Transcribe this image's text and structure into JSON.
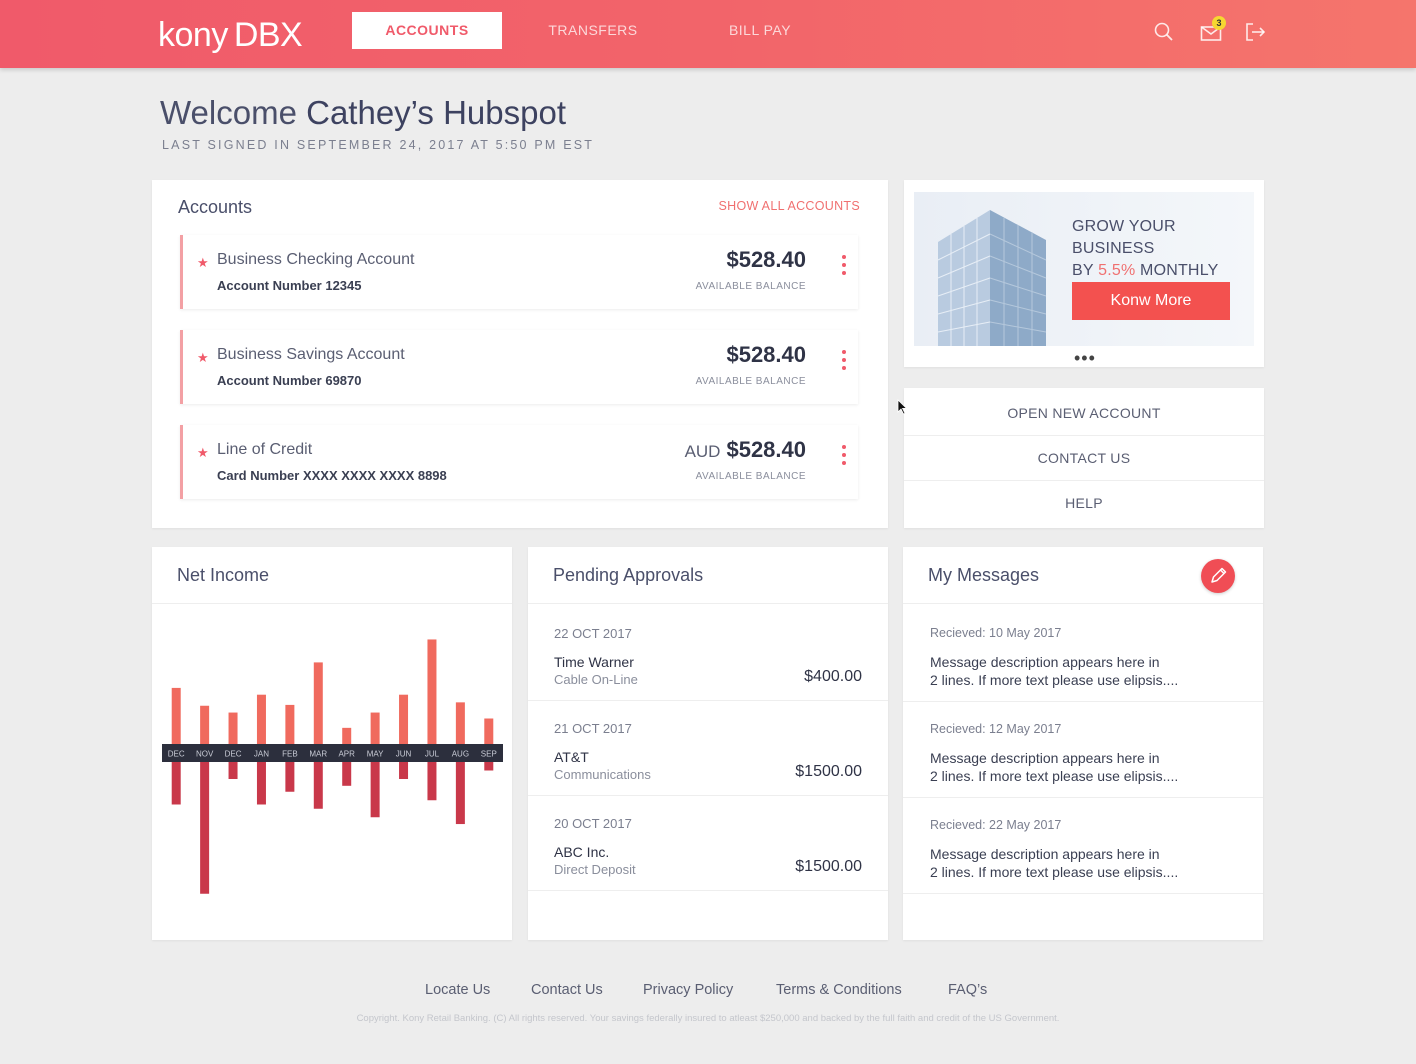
{
  "header": {
    "logo_kony": "kony",
    "logo_dbx": "DBX",
    "tabs": [
      {
        "label": "ACCOUNTS",
        "active": true
      },
      {
        "label": "TRANSFERS",
        "active": false
      },
      {
        "label": "BILL PAY",
        "active": false
      }
    ],
    "icons": [
      "search-icon",
      "mail-icon",
      "logout-icon"
    ],
    "mail_badge": "3",
    "colors": {
      "brand": "#f05a6a",
      "badge": "#f6d731"
    }
  },
  "welcome": {
    "prefix": "Welcome",
    "name": "Cathey’s Hubspot",
    "last_signed": "LAST SIGNED IN SEPTEMBER 24, 2017 AT 5:50 PM EST"
  },
  "accounts": {
    "title": "Accounts",
    "show_all": "SHOW ALL ACCOUNTS",
    "items": [
      {
        "name": "Business Checking Account",
        "number": "Account Number 12345",
        "currency": "",
        "balance": "$528.40",
        "balance_label": "AVAILABLE BALANCE"
      },
      {
        "name": "Business Savings Account",
        "number": "Account Number 69870",
        "currency": "",
        "balance": "$528.40",
        "balance_label": "AVAILABLE BALANCE"
      },
      {
        "name": "Line of Credit",
        "number": "Card Number XXXX XXXX XXXX 8898",
        "currency": "AUD",
        "balance": "$528.40",
        "balance_label": "AVAILABLE BALANCE"
      }
    ]
  },
  "promo": {
    "line1": "GROW YOUR BUSINESS",
    "line2_prefix": "BY ",
    "line2_pct": "5.5%",
    "line2_suffix": " MONTHLY",
    "button": "Konw More",
    "dots": "•••"
  },
  "quick_links": [
    "OPEN NEW ACCOUNT",
    "CONTACT US",
    "HELP"
  ],
  "net_income": {
    "title": "Net Income",
    "chart_data": {
      "type": "bar",
      "title": "Net Income",
      "categories": [
        "DEC",
        "NOV",
        "DEC",
        "JAN",
        "FEB",
        "MAR",
        "APR",
        "MAY",
        "JUN",
        "JUL",
        "AUG",
        "SEP"
      ],
      "series": [
        {
          "values": [
            66,
            45,
            37,
            58,
            46,
            96,
            19,
            37,
            58,
            123,
            49,
            30
          ]
        },
        {
          "values": [
            -50,
            -155,
            -20,
            -50,
            -35,
            -55,
            -28,
            -65,
            -20,
            -45,
            -73,
            -10
          ]
        }
      ],
      "colors": {
        "income": "#f06a5e",
        "expense": "#c9384a",
        "axis": "#2c2f3d"
      }
    }
  },
  "pending": {
    "title": "Pending Approvals",
    "items": [
      {
        "date": "22 OCT 2017",
        "name": "Time Warner",
        "sub": "Cable On-Line",
        "amount": "$400.00"
      },
      {
        "date": "21 OCT 2017",
        "name": "AT&T",
        "sub": "Communications",
        "amount": "$1500.00"
      },
      {
        "date": "20 OCT 2017",
        "name": "ABC Inc.",
        "sub": "Direct Deposit",
        "amount": "$1500.00"
      }
    ]
  },
  "messages": {
    "title": "My Messages",
    "items": [
      {
        "date": "Recieved: 10 May 2017",
        "line1": "Message description appears here in",
        "line2": "2 lines. If more text please use elipsis...."
      },
      {
        "date": "Recieved: 12 May 2017",
        "line1": "Message description appears here in",
        "line2": "2 lines. If more text please use elipsis...."
      },
      {
        "date": "Recieved: 22 May 2017",
        "line1": "Message description appears here in",
        "line2": "2 lines. If more text please use elipsis...."
      }
    ]
  },
  "footer": {
    "links": [
      "Locate Us",
      "Contact Us",
      "Privacy Policy",
      "Terms & Conditions",
      "FAQ’s"
    ],
    "copyright": "Copyright. Kony Retail Banking. (C) All rights reserved.   Your savings federally insured to atleast $250,000 and backed by the full faith and credit of the US Government."
  }
}
